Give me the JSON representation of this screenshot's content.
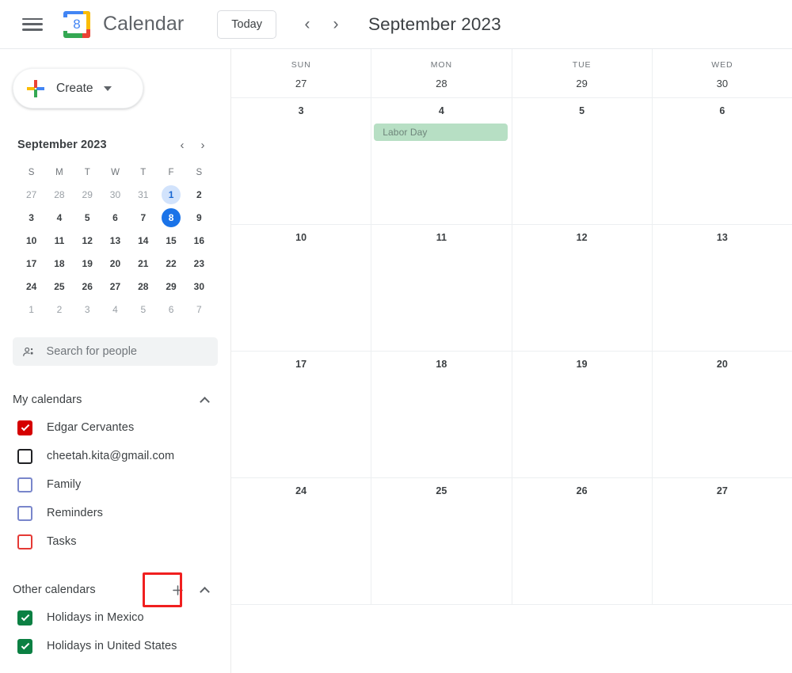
{
  "topbar": {
    "menu_icon": "hamburger-icon",
    "logo_day": "8",
    "brand": "Calendar",
    "today_label": "Today",
    "prev_icon": "‹",
    "next_icon": "›",
    "period_title": "September 2023"
  },
  "sidebar": {
    "create": {
      "label": "Create",
      "icon": "plus-icon",
      "caret": "chevron-down-icon"
    },
    "mini_calendar": {
      "title": "September 2023",
      "prev_icon": "‹",
      "next_icon": "›",
      "dow": [
        "S",
        "M",
        "T",
        "W",
        "T",
        "F",
        "S"
      ],
      "weeks": [
        [
          {
            "n": "27",
            "muted": true
          },
          {
            "n": "28",
            "muted": true
          },
          {
            "n": "29",
            "muted": true
          },
          {
            "n": "30",
            "muted": true
          },
          {
            "n": "31",
            "muted": true
          },
          {
            "n": "1",
            "muted": false,
            "state": "selected"
          },
          {
            "n": "2",
            "muted": false
          }
        ],
        [
          {
            "n": "3"
          },
          {
            "n": "4"
          },
          {
            "n": "5"
          },
          {
            "n": "6"
          },
          {
            "n": "7"
          },
          {
            "n": "8",
            "state": "today"
          },
          {
            "n": "9"
          }
        ],
        [
          {
            "n": "10"
          },
          {
            "n": "11"
          },
          {
            "n": "12"
          },
          {
            "n": "13"
          },
          {
            "n": "14"
          },
          {
            "n": "15"
          },
          {
            "n": "16"
          }
        ],
        [
          {
            "n": "17"
          },
          {
            "n": "18"
          },
          {
            "n": "19"
          },
          {
            "n": "20"
          },
          {
            "n": "21"
          },
          {
            "n": "22"
          },
          {
            "n": "23"
          }
        ],
        [
          {
            "n": "24"
          },
          {
            "n": "25"
          },
          {
            "n": "26"
          },
          {
            "n": "27"
          },
          {
            "n": "28"
          },
          {
            "n": "29"
          },
          {
            "n": "30"
          }
        ],
        [
          {
            "n": "1",
            "muted": true
          },
          {
            "n": "2",
            "muted": true
          },
          {
            "n": "3",
            "muted": true
          },
          {
            "n": "4",
            "muted": true
          },
          {
            "n": "5",
            "muted": true
          },
          {
            "n": "6",
            "muted": true
          },
          {
            "n": "7",
            "muted": true
          }
        ]
      ]
    },
    "people_search": {
      "placeholder": "Search for people",
      "value": "",
      "icon": "person-add-icon"
    },
    "my_calendars": {
      "title": "My calendars",
      "collapse_icon": "chevron-up-icon",
      "items": [
        {
          "label": "Edgar Cervantes",
          "checked": true,
          "color": "#d50000"
        },
        {
          "label": "cheetah.kita@gmail.com",
          "checked": false,
          "color": "#202124"
        },
        {
          "label": "Family",
          "checked": false,
          "color": "#7986cb"
        },
        {
          "label": "Reminders",
          "checked": false,
          "color": "#7986cb"
        },
        {
          "label": "Tasks",
          "checked": false,
          "color": "#e53935"
        }
      ]
    },
    "other_calendars": {
      "title": "Other calendars",
      "add_icon": "plus-icon",
      "add_label": "+",
      "collapse_icon": "chevron-up-icon",
      "highlighted": true,
      "highlight_color": "#f01f1f",
      "items": [
        {
          "label": "Holidays in Mexico",
          "checked": true,
          "color": "#0b8043"
        },
        {
          "label": "Holidays in United States",
          "checked": true,
          "color": "#0b8043"
        }
      ]
    }
  },
  "calendar_grid": {
    "columns": [
      {
        "dow": "SUN",
        "date": "27"
      },
      {
        "dow": "MON",
        "date": "28"
      },
      {
        "dow": "TUE",
        "date": "29"
      },
      {
        "dow": "WED",
        "date": "30"
      }
    ],
    "weeks": [
      {
        "days": [
          {
            "n": "3"
          },
          {
            "n": "4",
            "events": [
              {
                "title": "Labor Day",
                "color": "#b7dfc4",
                "text_color": "#6e857a"
              }
            ]
          },
          {
            "n": "5"
          },
          {
            "n": "6"
          }
        ]
      },
      {
        "days": [
          {
            "n": "10"
          },
          {
            "n": "11"
          },
          {
            "n": "12"
          },
          {
            "n": "13"
          }
        ]
      },
      {
        "days": [
          {
            "n": "17"
          },
          {
            "n": "18"
          },
          {
            "n": "19"
          },
          {
            "n": "20"
          }
        ]
      },
      {
        "days": [
          {
            "n": "24"
          },
          {
            "n": "25"
          },
          {
            "n": "26"
          },
          {
            "n": "27"
          }
        ]
      }
    ]
  }
}
